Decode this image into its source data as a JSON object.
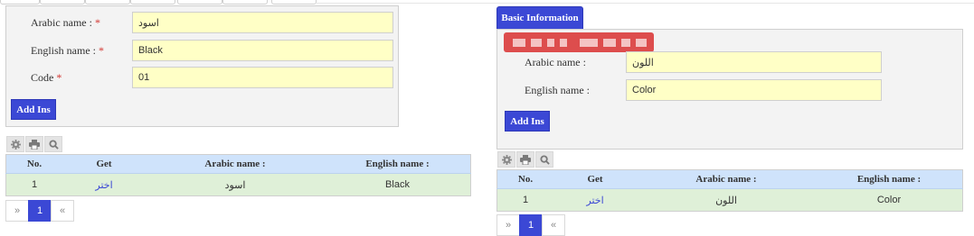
{
  "left_form": {
    "arabic_label": "Arabic name :",
    "english_label": "English name :",
    "code_label": "Code",
    "required_mark": "*",
    "arabic_value": "اسود",
    "english_value": "Black",
    "code_value": "01",
    "add_button": "Add Ins"
  },
  "left_grid": {
    "headers": [
      "No.",
      "Get",
      "Arabic name :",
      "English name :"
    ],
    "row": {
      "no": "1",
      "get": "اختر",
      "arabic": "اسود",
      "english": "Black"
    }
  },
  "left_pager": {
    "prev": "»",
    "page": "1",
    "next": "«"
  },
  "right_tab": {
    "label": "Basic Information"
  },
  "right_form": {
    "arabic_label": "Arabic name :",
    "english_label": "English name :",
    "arabic_value": "اللون",
    "english_value": "Color",
    "add_button": "Add Ins"
  },
  "right_grid": {
    "headers": [
      "No.",
      "Get",
      "Arabic name :",
      "English name :"
    ],
    "row": {
      "no": "1",
      "get": "اختر",
      "arabic": "اللون",
      "english": "Color"
    }
  },
  "right_pager": {
    "prev": "»",
    "page": "1",
    "next": "«"
  },
  "icons": [
    "gear-icon",
    "print-icon",
    "search-icon"
  ]
}
